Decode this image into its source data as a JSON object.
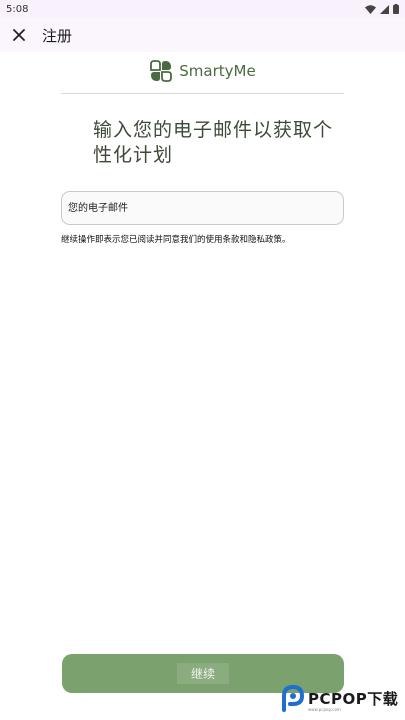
{
  "status_bar": {
    "time": "5:08"
  },
  "app_bar": {
    "title": "注册",
    "close_icon": "close-icon"
  },
  "logo": {
    "text": "SmartyMe",
    "icon": "clover-logo-icon",
    "color": "#4a6b40"
  },
  "headline": "输入您的电子邮件以获取个性化计划",
  "email": {
    "placeholder": "您的电子邮件",
    "value": ""
  },
  "terms_text": "继续操作即表示您已阅读并同意我们的使用条款和隐私政策。",
  "continue_button": {
    "label": "继续",
    "color": "#7aa16e"
  },
  "watermark": {
    "text": "PCPOP下载",
    "subtext": "www.pcpop.com"
  }
}
